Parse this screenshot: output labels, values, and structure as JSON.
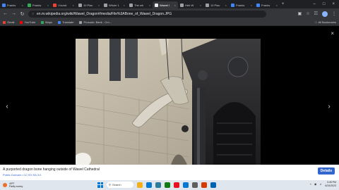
{
  "browser": {
    "tabs": [
      {
        "label": "Franks",
        "color": "#4285f4",
        "active": false
      },
      {
        "label": "Franks",
        "color": "#34a853",
        "active": false
      },
      {
        "label": "I found",
        "color": "#ea4335",
        "active": false
      },
      {
        "label": "10 Plac",
        "color": "#9aa0a6",
        "active": false
      },
      {
        "label": "Whole 1",
        "color": "#9aa0a6",
        "active": false
      },
      {
        "label": "The wh",
        "color": "#9aa0a6",
        "active": false
      },
      {
        "label": "Wawel l",
        "color": "#e8eaed",
        "active": true
      },
      {
        "label": "Heb W",
        "color": "#9aa0a6",
        "active": false
      },
      {
        "label": "10 Plac",
        "color": "#9aa0a6",
        "active": false
      },
      {
        "label": "Franks",
        "color": "#4285f4",
        "active": false
      },
      {
        "label": "Franks",
        "color": "#4285f4",
        "active": false
      }
    ],
    "new_tab": "+",
    "url": "en.m.wikipedia.org/wiki/Wawel_Dragon#/media/File%3ABone_of_Wawel_Dragon.JPG",
    "bookmarks": [
      {
        "label": "Gmail",
        "color": "#ea4335"
      },
      {
        "label": "YouTube",
        "color": "#ff0000"
      },
      {
        "label": "Maps",
        "color": "#34a853"
      },
      {
        "label": "Translate",
        "color": "#4285f4"
      },
      {
        "label": "Prosudo: Bank - Cro...",
        "color": "#9aa0a6"
      }
    ],
    "all_bookmarks": "All Bookmarks"
  },
  "viewer": {
    "close": "×",
    "prev": "‹",
    "next": "›",
    "caption": "A purported dragon bone hanging outside of Wawel Cathedral",
    "license": "Public Domain • CC BY-SA 3.0",
    "details_label": "Details"
  },
  "taskbar": {
    "weather_temp": "49°F",
    "weather_desc": "Partly sunny",
    "search_placeholder": "Search",
    "time": "3:45 PM",
    "date": "6/24/2023",
    "apps": [
      "#f2b01e",
      "#0078d4",
      "#2d7d9a",
      "#107c10",
      "#e81123",
      "#0078d4",
      "#5e5e5e",
      "#d83b01",
      "#0063b1"
    ]
  }
}
